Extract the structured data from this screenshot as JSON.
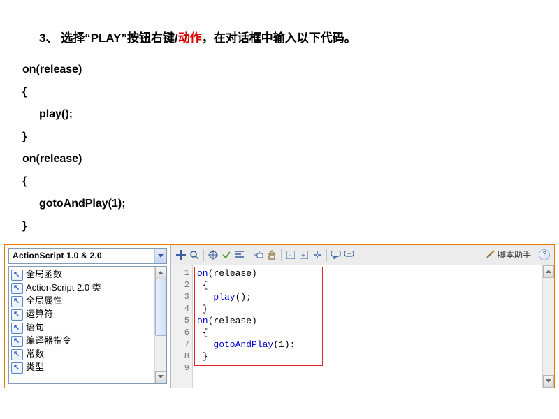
{
  "instruction": {
    "num": "3、",
    "pre": " 选择",
    "q1": "“PLAY”",
    "mid": "按钮右键/",
    "red": "动作",
    "post": "，在对话框中输入以下代码。"
  },
  "text_code": {
    "l1": "on(release)",
    "l2": "{",
    "l3": "play();",
    "l4": "}",
    "l5": "on(release)",
    "l6": "{",
    "l7": "gotoAndPlay(1);",
    "l8": "}"
  },
  "panel": {
    "dropdown_label": "ActionScript 1.0 & 2.0",
    "tree": [
      "全局函数",
      "ActionScript 2.0 类",
      "全局属性",
      "运算符",
      "语句",
      "编译器指令",
      "常数",
      "类型"
    ],
    "toolbar_label": "脚本助手",
    "help": "?",
    "gutter": [
      "1",
      "2",
      "3",
      "4",
      "5",
      "6",
      "7",
      "8",
      "9"
    ],
    "code": {
      "l1a": "on",
      "l1b": "(release)",
      "l2": " {",
      "l3a": "   ",
      "l3b": "play",
      "l3c": "();",
      "l4": " }",
      "l5a": "on",
      "l5b": "(release)",
      "l6": " {",
      "l7a": "   ",
      "l7b": "gotoAndPlay",
      "l7c": "(1):",
      "l8": " }"
    }
  }
}
